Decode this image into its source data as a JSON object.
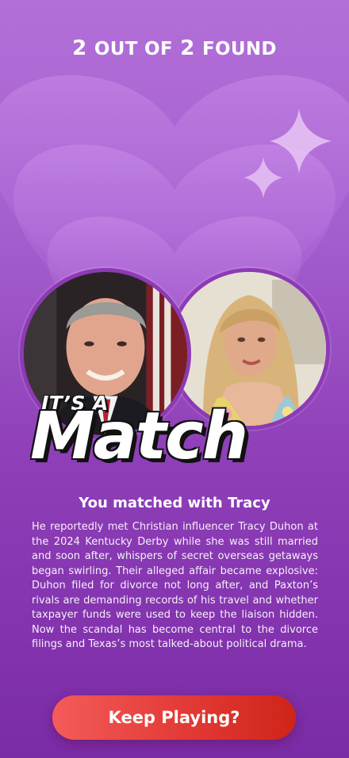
{
  "header": {
    "count_found": "2",
    "out_of_label": "OUT OF",
    "count_total": "2",
    "found_label": "FOUND"
  },
  "match": {
    "intro": "IT’S A",
    "title": "Match",
    "subtitle": "You matched with Tracy",
    "story": "He reportedly met Christian influencer Tracy Duhon at the 2024 Kentucky Derby while she was still married and soon after, whispers of secret overseas getaways began swirling. Their alleged affair became explosive: Duhon filed for divorce not long after, and Paxton’s rivals are demanding records of his travel and whether taxpayer funds were used to keep the liaison hidden. Now the scandal has become central to the divorce filings and Texas’s most talked-about political drama."
  },
  "actions": {
    "keep_playing_label": "Keep Playing?"
  },
  "colors": {
    "background_top": "#b36fd8",
    "background_bottom": "#7a2ba6",
    "heart": "#c98ae8",
    "avatar_ring": "#8d3ab4",
    "button_start": "#f45b58",
    "button_end": "#cf2418"
  },
  "icons": {
    "hearts": "heart-decoration",
    "sparkle": "sparkle-icon"
  }
}
